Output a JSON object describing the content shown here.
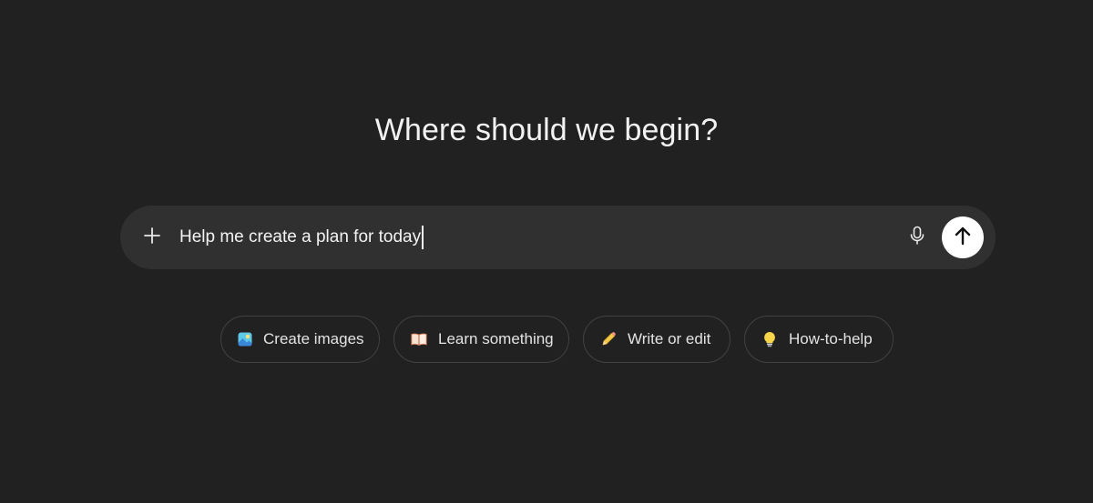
{
  "heading": "Where should we begin?",
  "composer": {
    "value": "Help me create a plan for today",
    "plus_icon": "plus-icon",
    "mic_icon": "microphone-icon",
    "send_icon": "arrow-up-icon"
  },
  "suggestions": [
    {
      "label": "Create images",
      "icon": "image-icon"
    },
    {
      "label": "Learn something",
      "icon": "book-icon"
    },
    {
      "label": "Write or edit",
      "icon": "pencil-icon"
    },
    {
      "label": "How-to-help",
      "icon": "lightbulb-icon"
    }
  ],
  "colors": {
    "background": "#212121",
    "composer": "#303030",
    "send_button": "#ffffff",
    "chip_border": "#424242",
    "text": "#ececec"
  }
}
